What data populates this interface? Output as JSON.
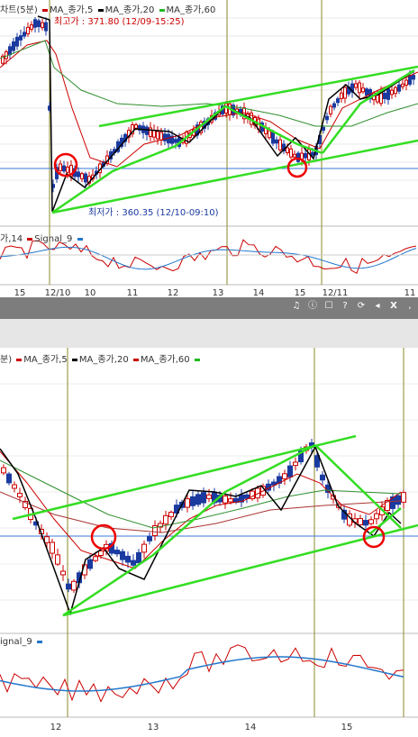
{
  "top": {
    "title": "차트(5분)",
    "legend": [
      {
        "label": "MA_종가,5",
        "color": "#cc0000"
      },
      {
        "label": "MA_종가,20",
        "color": "#000000"
      },
      {
        "label": "MA_종가,60",
        "color": "#22bb22"
      }
    ],
    "high_label": "최고가 : 371.80 (12/09-15:25)",
    "low_label": "최저가 : 360.35 (12/10-09:10)",
    "indicator_legend": [
      {
        "label": "가,14",
        "color": "#cc0000"
      },
      {
        "label": "Signal_9",
        "color": "#2277cc"
      }
    ],
    "x_ticks": [
      "15",
      "12/10",
      "10",
      "11",
      "12",
      "13",
      "14",
      "15",
      "12/11",
      "11"
    ]
  },
  "toolbar": {
    "icons": [
      "headset-icon",
      "info-icon",
      "checkbox-icon",
      "help-icon",
      "refresh-icon",
      "arrow-left-icon",
      "close-icon"
    ],
    "icon_glyphs": [
      "♫",
      "ⓘ",
      "☐",
      "?",
      "⟳",
      "◂",
      "X",
      ","
    ]
  },
  "bottom": {
    "legend_prefix": "분)",
    "legend": [
      {
        "label": "MA_종가,5",
        "color": "#cc0000"
      },
      {
        "label": "MA_종가,20",
        "color": "#000000"
      },
      {
        "label": "MA_종가,60",
        "color": "#22bb22"
      }
    ],
    "indicator_legend": [
      {
        "label": "ignal_9",
        "color": "#2277cc"
      }
    ],
    "x_ticks": [
      "12",
      "13",
      "14",
      "15"
    ]
  },
  "colors": {
    "bull": "#cc0000",
    "bear": "#1a3aa0",
    "trend": "#33dd22",
    "zigzag": "#000000",
    "circle": "#ee0000",
    "vline": "#8a8a2a",
    "hline": "#3a7ad8"
  }
}
